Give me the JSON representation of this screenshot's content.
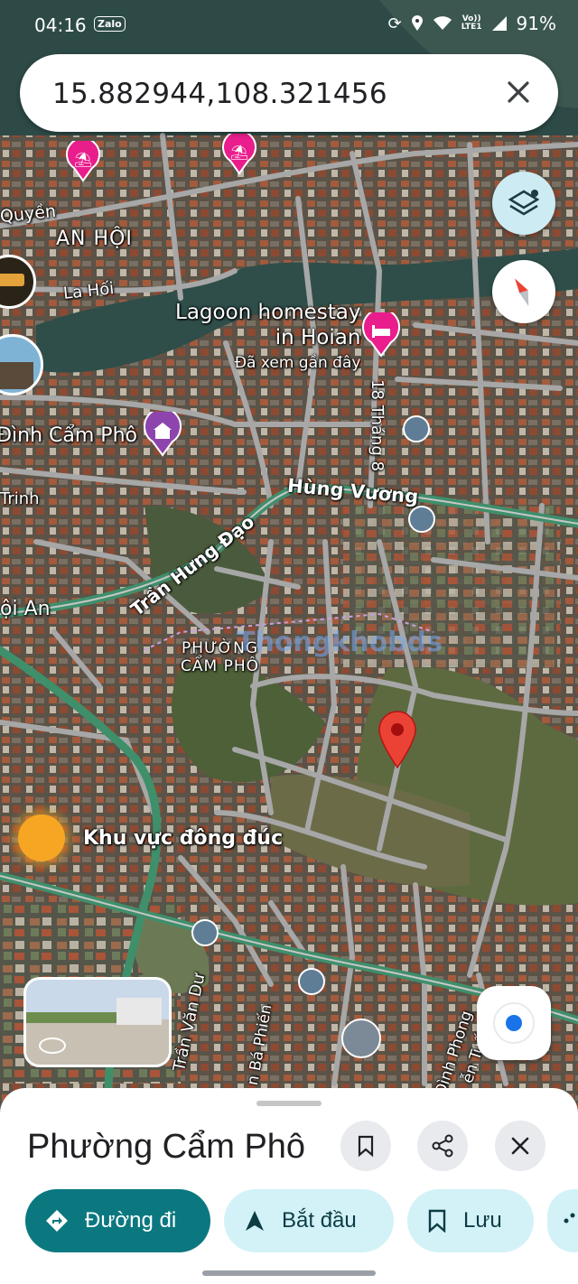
{
  "status_bar": {
    "time": "04:16",
    "zalo_badge": "Zalo",
    "network_top": "Vo))",
    "network_bottom": "LTE1",
    "battery": "91%"
  },
  "search": {
    "query": "15.882944,108.321456"
  },
  "map": {
    "labels": {
      "quyen": "Quyền",
      "an_hoi": "AN HỘI",
      "la_hoi": "La Hối",
      "lagoon_line1": "Lagoon homestay",
      "lagoon_line2": "in Hoian",
      "lagoon_sub": "Đã xem gần đây",
      "dinh_cam_pho": "Đình Cẩm Phô",
      "trinh": "Trinh",
      "thang8": "18 Tháng 8",
      "hung_vuong": "Hùng Vương",
      "tran_hung_dao": "Trần Hưng Đạo",
      "hoi_an": "ội An",
      "phuong_cam_pho_1": "PHƯỜNG",
      "phuong_cam_pho_2": "CẨM PHÔ",
      "watermark": "Thongkhobds",
      "busy_area": "Khu vực đông đúc",
      "tran_van_du": "Trần Văn Dư",
      "ba_phien": "n Bá Phiến",
      "dinh_phong": "Đình Phong",
      "tuan": "ễn Tuấn"
    },
    "colors": {
      "pin": "#ea4335",
      "poi_pink": "#e91e8c",
      "poi_purple": "#8e44ad",
      "road": "#9e9e9e",
      "major_road": "#2e8b57",
      "water": "#2d4a47"
    }
  },
  "sheet": {
    "title": "Phường Cẩm Phô",
    "directions_label": "Đường đi",
    "start_label": "Bắt đầu",
    "save_label": "Lưu",
    "colors": {
      "primary": "#0b7880",
      "chip_bg": "#d3f2f8"
    }
  }
}
